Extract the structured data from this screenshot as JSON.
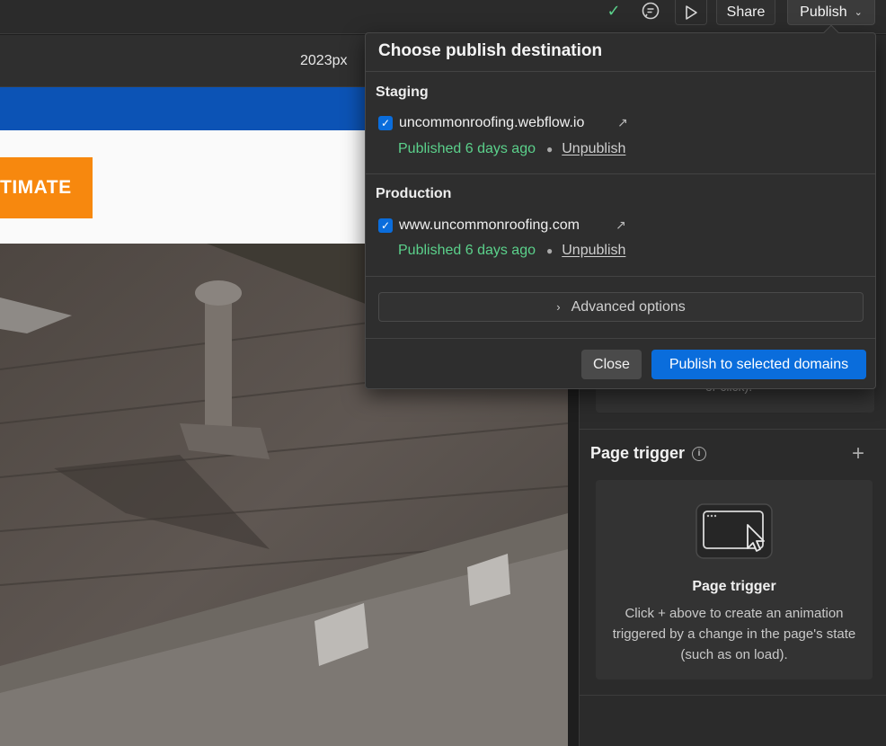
{
  "topbar": {
    "share_label": "Share",
    "publish_label": "Publish"
  },
  "canvas": {
    "width_label": "2023px",
    "cta_label": "TIMATE"
  },
  "publish_popover": {
    "title": "Choose publish destination",
    "staging": {
      "label": "Staging",
      "domain": "uncommonroofing.webflow.io",
      "status": "Published 6 days ago",
      "unpublish_label": "Unpublish"
    },
    "production": {
      "label": "Production",
      "domain": "www.uncommonroofing.com",
      "status": "Published 6 days ago",
      "unpublish_label": "Unpublish"
    },
    "advanced_label": "Advanced options",
    "close_label": "Close",
    "publish_selected_label": "Publish to selected domains"
  },
  "right_panel": {
    "partial_hint": "or click).",
    "page_trigger": {
      "title": "Page trigger",
      "card_title": "Page trigger",
      "card_desc": "Click + above to create an animation triggered by a change in the page's state (such as on load)."
    }
  },
  "colors": {
    "accent_blue": "#0a6ddc",
    "published_green": "#5bd18b",
    "brand_orange": "#f7880e",
    "brand_blue": "#0c53b5"
  },
  "icons": [
    "check-icon",
    "comment-icon",
    "play-icon",
    "chevron-down-icon",
    "external-link-icon",
    "chevron-right-icon",
    "info-icon",
    "plus-icon",
    "cursor-window-icon"
  ]
}
